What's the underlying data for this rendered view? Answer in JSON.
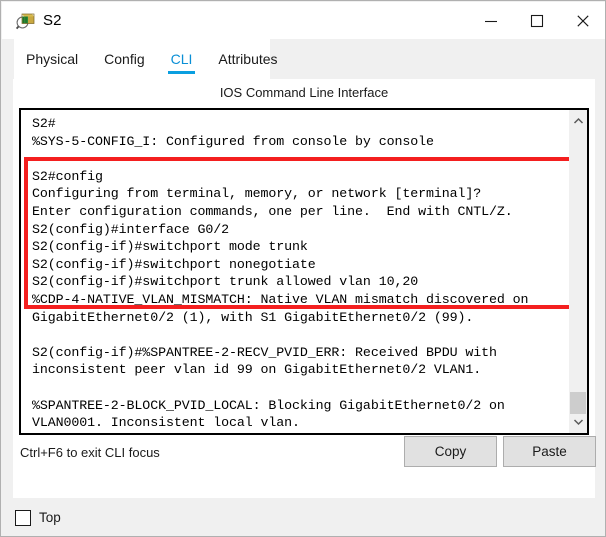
{
  "window": {
    "title": "S2",
    "icon": "packet-tracer-device-icon",
    "controls": {
      "minimize": "minimize-icon",
      "maximize": "maximize-icon",
      "close": "close-icon"
    }
  },
  "tabs": [
    {
      "label": "Physical",
      "active": false
    },
    {
      "label": "Config",
      "active": false
    },
    {
      "label": "CLI",
      "active": true
    },
    {
      "label": "Attributes",
      "active": false
    }
  ],
  "main": {
    "heading": "IOS Command Line Interface",
    "console_text": "S2#\n%SYS-5-CONFIG_I: Configured from console by console\n\nS2#config\nConfiguring from terminal, memory, or network [terminal]?\nEnter configuration commands, one per line.  End with CNTL/Z.\nS2(config)#interface G0/2\nS2(config-if)#switchport mode trunk\nS2(config-if)#switchport nonegotiate\nS2(config-if)#switchport trunk allowed vlan 10,20\n%CDP-4-NATIVE_VLAN_MISMATCH: Native VLAN mismatch discovered on\nGigabitEthernet0/2 (1), with S1 GigabitEthernet0/2 (99).\n\nS2(config-if)#%SPANTREE-2-RECV_PVID_ERR: Received BPDU with\ninconsistent peer vlan id 99 on GigabitEthernet0/2 VLAN1.\n\n%SPANTREE-2-BLOCK_PVID_LOCAL: Blocking GigabitEthernet0/2 on\nVLAN0001. Inconsistent local vlan.",
    "annotation_color": "#f41f1f",
    "scrollbar": {
      "up_arrow": "chevron-up-icon",
      "down_arrow": "chevron-down-icon"
    },
    "hint": "Ctrl+F6 to exit CLI focus",
    "copy_label": "Copy",
    "paste_label": "Paste"
  },
  "bottom": {
    "top_checkbox_label": "Top",
    "top_checkbox_checked": false
  }
}
